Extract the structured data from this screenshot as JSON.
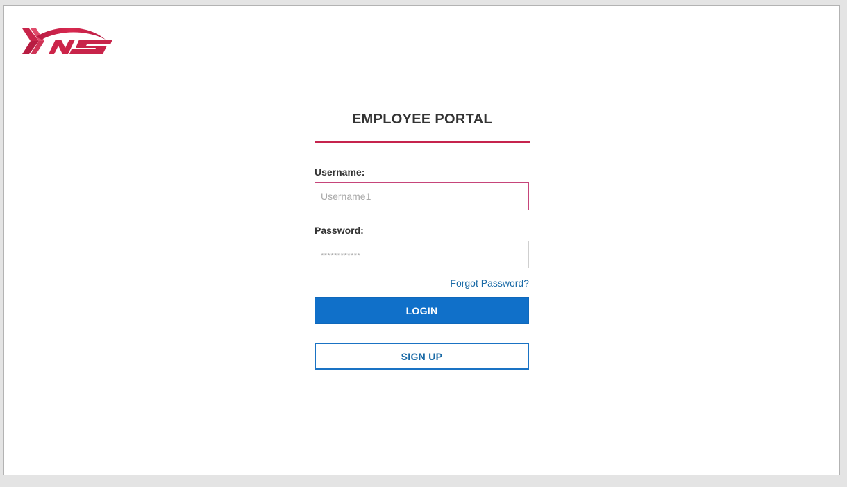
{
  "brand": {
    "logo_text": "YNS",
    "logo_icon": "yns-logo-icon",
    "color": "#c6244e"
  },
  "portal": {
    "title": "EMPLOYEE PORTAL"
  },
  "form": {
    "username_label": "Username:",
    "username_placeholder": "Username1",
    "password_label": "Password:",
    "password_placeholder": "************",
    "forgot_link": "Forgot Password?",
    "login_label": "LOGIN",
    "signup_label": "SIGN UP"
  },
  "colors": {
    "accent": "#c6244e",
    "primary": "#1070c9",
    "link": "#1a6aa6"
  }
}
